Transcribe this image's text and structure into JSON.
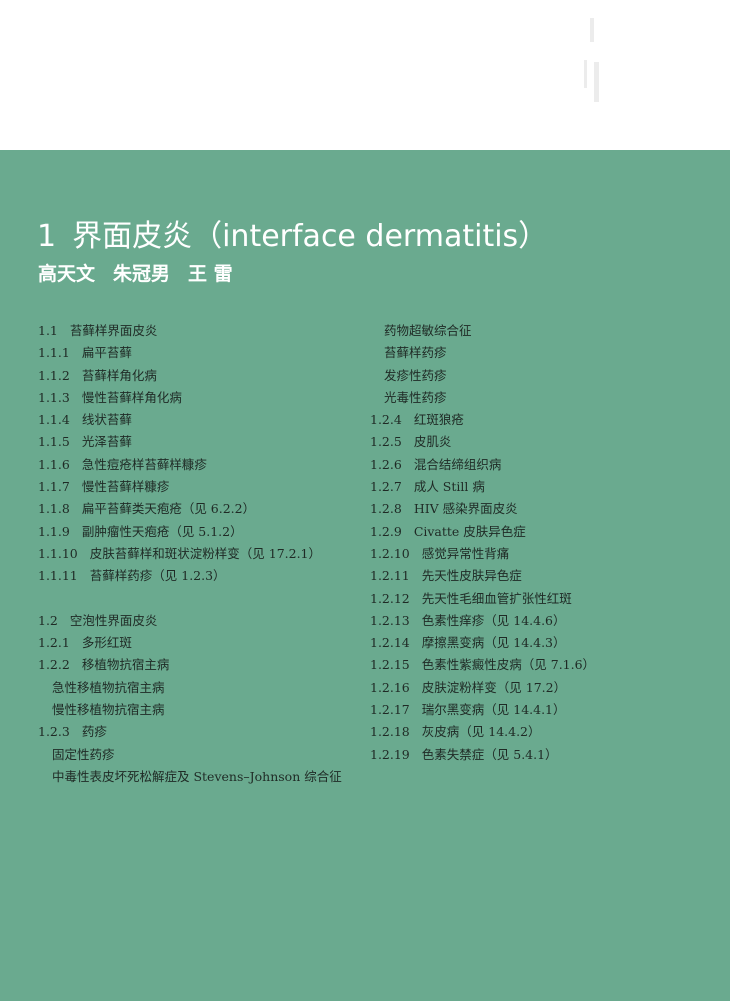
{
  "header": {
    "number": "1",
    "title": "界面皮炎（interface dermatitis）",
    "authors": [
      "高天文",
      "朱冠男",
      "王 雷"
    ]
  },
  "toc_left": [
    {
      "no": "1.1",
      "text": "苔藓样界面皮炎"
    },
    {
      "no": "1.1.1",
      "text": "扁平苔藓"
    },
    {
      "no": "1.1.2",
      "text": "苔藓样角化病"
    },
    {
      "no": "1.1.3",
      "text": "慢性苔藓样角化病"
    },
    {
      "no": "1.1.4",
      "text": "线状苔藓"
    },
    {
      "no": "1.1.5",
      "text": "光泽苔藓"
    },
    {
      "no": "1.1.6",
      "text": "急性痘疮样苔藓样糠疹"
    },
    {
      "no": "1.1.7",
      "text": "慢性苔藓样糠疹"
    },
    {
      "no": "1.1.8",
      "text": "扁平苔藓类天疱疮（见 6.2.2）"
    },
    {
      "no": "1.1.9",
      "text": "副肿瘤性天疱疮（见 5.1.2）"
    },
    {
      "no": "1.1.10",
      "text": "皮肤苔藓样和斑状淀粉样变（见 17.2.1）"
    },
    {
      "no": "1.1.11",
      "text": "苔藓样药疹（见 1.2.3）"
    },
    {
      "no": "",
      "text": ""
    },
    {
      "no": "1.2",
      "text": "空泡性界面皮炎"
    },
    {
      "no": "1.2.1",
      "text": "多形红斑"
    },
    {
      "no": "1.2.2",
      "text": "移植物抗宿主病"
    },
    {
      "no": "",
      "text": "急性移植物抗宿主病",
      "indent": true
    },
    {
      "no": "",
      "text": "慢性移植物抗宿主病",
      "indent": true
    },
    {
      "no": "1.2.3",
      "text": "药疹"
    },
    {
      "no": "",
      "text": "固定性药疹",
      "indent": true
    },
    {
      "no": "",
      "text": "中毒性表皮坏死松解症及 Stevens–Johnson 综合征",
      "indent": true
    }
  ],
  "toc_right": [
    {
      "no": "",
      "text": "药物超敏综合征",
      "indent": true
    },
    {
      "no": "",
      "text": "苔藓样药疹",
      "indent": true
    },
    {
      "no": "",
      "text": "发疹性药疹",
      "indent": true
    },
    {
      "no": "",
      "text": "光毒性药疹",
      "indent": true
    },
    {
      "no": "1.2.4",
      "text": "红斑狼疮"
    },
    {
      "no": "1.2.5",
      "text": "皮肌炎"
    },
    {
      "no": "1.2.6",
      "text": "混合结缔组织病"
    },
    {
      "no": "1.2.7",
      "text": "成人 Still 病"
    },
    {
      "no": "1.2.8",
      "text": "HIV 感染界面皮炎"
    },
    {
      "no": "1.2.9",
      "text": "Civatte 皮肤异色症"
    },
    {
      "no": "1.2.10",
      "text": "感觉异常性背痛"
    },
    {
      "no": "1.2.11",
      "text": "先天性皮肤异色症"
    },
    {
      "no": "1.2.12",
      "text": "先天性毛细血管扩张性红斑"
    },
    {
      "no": "1.2.13",
      "text": "色素性痒疹（见 14.4.6）"
    },
    {
      "no": "1.2.14",
      "text": "摩擦黑变病（见 14.4.3）"
    },
    {
      "no": "1.2.15",
      "text": "色素性紫癜性皮病（见 7.1.6）"
    },
    {
      "no": "1.2.16",
      "text": "皮肤淀粉样变（见 17.2）"
    },
    {
      "no": "1.2.17",
      "text": "瑞尔黑变病（见 14.4.1）"
    },
    {
      "no": "1.2.18",
      "text": "灰皮病（见 14.4.2）"
    },
    {
      "no": "1.2.19",
      "text": "色素失禁症（见 5.4.1）"
    }
  ],
  "colors": {
    "panel": "#6aaa8f",
    "text_dark": "#1f2a25",
    "title": "#ffffff"
  }
}
